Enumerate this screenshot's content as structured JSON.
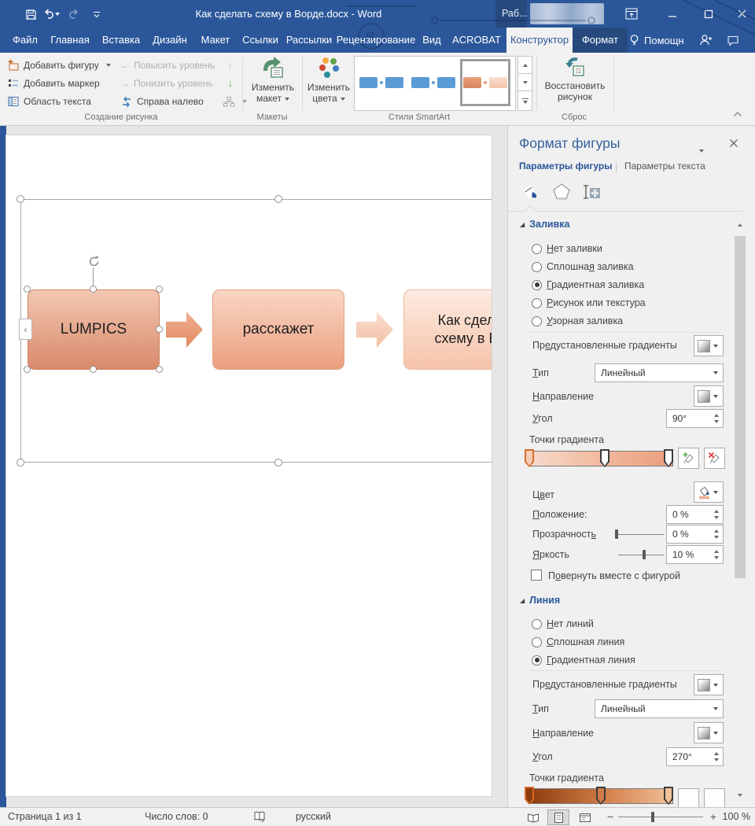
{
  "titlebar": {
    "title": "Как сделать схему в Ворде.docx - Word",
    "account": "Раб..."
  },
  "tabs": {
    "file": "Файл",
    "home": "Главная",
    "insert": "Вставка",
    "design": "Дизайн",
    "layout": "Макет",
    "references": "Ссылки",
    "mailings": "Рассылки",
    "review": "Рецензирование",
    "view": "Вид",
    "acrobat": "ACROBAT",
    "constructor": "Конструктор",
    "format": "Формат",
    "assistant": "Помощн"
  },
  "ribbon": {
    "create": {
      "label": "Создание рисунка",
      "add_shape": "Добавить фигуру",
      "add_bullet": "Добавить маркер",
      "text_pane": "Область текста",
      "promote": "Повысить уровень",
      "demote": "Понизить уровень",
      "rtl": "Справа налево"
    },
    "layouts": {
      "label": "Макеты",
      "change_layout": "Изменить макет"
    },
    "styles": {
      "label": "Стили SmartArt",
      "change_colors": "Изменить цвета"
    },
    "reset": {
      "label": "Сброс",
      "restore": "Восстановить рисунок"
    }
  },
  "canvas": {
    "shape1": "LUMPICS",
    "shape2": "расскажет",
    "shape3_line1": "Как сдела",
    "shape3_line2": "схему в Во"
  },
  "panel": {
    "title": "Формат фигуры",
    "tab_shape": "Параметры фигуры",
    "tab_text": "Параметры текста",
    "fill": {
      "section": "Заливка",
      "r1": "Нет заливки",
      "r2": "Сплошная заливка",
      "r3": "Градиентная заливка",
      "r4": "Рисунок или текстура",
      "r5": "Узорная заливка",
      "preset": "Предустановленные градиенты",
      "type": "Тип",
      "type_value": "Линейный",
      "direction": "Направление",
      "angle": "Угол",
      "angle_value": "90°",
      "stops": "Точки градиента",
      "color": "Цвет",
      "position": "Положение:",
      "position_value": "0 %",
      "transparency": "Прозрачность",
      "transparency_value": "0 %",
      "brightness": "Яркость",
      "brightness_value": "10 %",
      "rotate": "Повернуть вместе с фигурой"
    },
    "line": {
      "section": "Линия",
      "r1": "Нет линий",
      "r2": "Сплошная линия",
      "r3": "Градиентная линия",
      "preset": "Предустановленные градиенты",
      "type": "Тип",
      "type_value": "Линейный",
      "direction": "Направление",
      "angle": "Угол",
      "angle_value": "270°",
      "stops": "Точки градиента"
    }
  },
  "status": {
    "page": "Страница 1 из 1",
    "words": "Число слов: 0",
    "language": "русский",
    "zoom": "100 %"
  },
  "colors": {
    "titlebar_blue": "#2b579a",
    "contextual_tab_blue": "#26497e",
    "shape_gradient_light": "#f3c8b2",
    "shape_gradient_dark": "#d8896a",
    "gallery_blue": "#5b9bd5"
  }
}
